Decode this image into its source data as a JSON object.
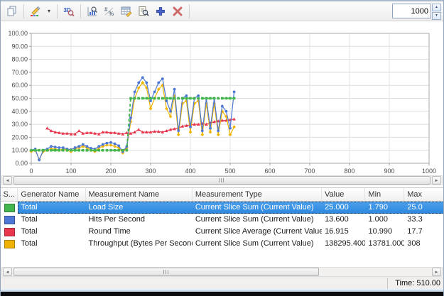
{
  "toolbar": {
    "icons": [
      {
        "name": "copy"
      },
      {
        "name": "edit-chart"
      },
      {
        "name": "zoom-3d"
      },
      {
        "name": "chart-zoom"
      },
      {
        "name": "number-format"
      },
      {
        "name": "edit-table"
      },
      {
        "name": "preview"
      },
      {
        "name": "add"
      },
      {
        "name": "delete"
      }
    ],
    "spinner_value": "1000"
  },
  "chart_data": {
    "type": "line",
    "title": "",
    "xlabel": "",
    "ylabel": "",
    "xlim": [
      0,
      1000
    ],
    "ylim": [
      0,
      100
    ],
    "x_tick_step": 100,
    "y_tick_step": 10,
    "grid": true,
    "legend_position": "table-below",
    "x": [
      0,
      10,
      20,
      30,
      40,
      50,
      60,
      70,
      80,
      90,
      100,
      110,
      120,
      130,
      140,
      150,
      160,
      170,
      180,
      190,
      200,
      210,
      220,
      230,
      240,
      250,
      260,
      270,
      280,
      290,
      300,
      310,
      320,
      330,
      340,
      350,
      360,
      370,
      380,
      390,
      400,
      410,
      420,
      430,
      440,
      450,
      460,
      470,
      480,
      490,
      500,
      510
    ],
    "series": [
      {
        "name": "Load Size",
        "color": "#44b64e",
        "marker": "square",
        "dash": true,
        "values": [
          10,
          10,
          10,
          10,
          10,
          10,
          10,
          10,
          10,
          10,
          10,
          10,
          10,
          10,
          10,
          10,
          10,
          10,
          10,
          10,
          10,
          10,
          10,
          10,
          10,
          50,
          50,
          50,
          50,
          50,
          50,
          50,
          50,
          50,
          50,
          50,
          50,
          50,
          50,
          50,
          50,
          50,
          50,
          50,
          50,
          50,
          50,
          50,
          50,
          50,
          50,
          50
        ]
      },
      {
        "name": "Hits Per Second",
        "color": "#4c77d4",
        "marker": "circle",
        "dash": false,
        "values": [
          10,
          11,
          2.5,
          10,
          11,
          13,
          12.5,
          12,
          12,
          11,
          10.5,
          12,
          13,
          14.5,
          13,
          11.5,
          11,
          13,
          14.5,
          15.5,
          16,
          15,
          13.5,
          9,
          13,
          35,
          55,
          62,
          66,
          62,
          48,
          55,
          62,
          65,
          48,
          40,
          57,
          25,
          50,
          52,
          28,
          50,
          52,
          25,
          50,
          27,
          50,
          25,
          44,
          40,
          27,
          55
        ]
      },
      {
        "name": "Round Time",
        "color": "#e8364c",
        "marker": "triangle",
        "dash": false,
        "x": [
          40,
          50,
          60,
          70,
          80,
          90,
          100,
          110,
          120,
          130,
          140,
          150,
          160,
          170,
          180,
          190,
          200,
          210,
          220,
          230,
          240,
          250,
          260,
          270,
          280,
          290,
          300,
          310,
          320,
          330,
          340,
          350,
          360,
          370,
          380,
          390,
          400,
          410,
          420,
          430,
          440,
          450,
          460,
          470,
          480,
          490,
          500,
          510
        ],
        "values": [
          27,
          25,
          24,
          23.5,
          23,
          23,
          22.5,
          22.5,
          25,
          23,
          23.5,
          23.5,
          23,
          22.5,
          24,
          24,
          23.5,
          23.5,
          23,
          22.5,
          23.5,
          23,
          24,
          26,
          24,
          24,
          24,
          24.5,
          24.5,
          24,
          25,
          26,
          26.5,
          27,
          28.5,
          29,
          29.5,
          30,
          30,
          30.5,
          30,
          31,
          32,
          32.5,
          33,
          33,
          33.5,
          34
        ]
      },
      {
        "name": "Throughput (Bytes Per Second)",
        "color": "#f0b400",
        "marker": "diamond",
        "dash": false,
        "values": [
          9,
          10,
          3,
          9,
          10,
          11,
          11,
          10,
          11,
          10,
          9,
          11,
          12,
          13,
          12,
          10,
          9,
          12,
          13,
          14,
          14,
          13,
          12,
          8,
          12,
          32,
          50,
          58,
          62,
          58,
          42,
          50,
          57,
          60,
          42,
          36,
          52,
          22,
          46,
          48,
          24,
          46,
          48,
          22,
          46,
          24,
          46,
          22,
          40,
          36,
          22,
          28
        ]
      }
    ]
  },
  "table": {
    "columns": [
      "S...",
      "Generator Name",
      "Measurement Name",
      "Measurement Type",
      "Value",
      "Min",
      "Max"
    ],
    "rows": [
      {
        "color": "#44b64e",
        "generator": "Total",
        "name": "Load Size",
        "type": "Current Slice Sum (Current Value)",
        "value": "25.000",
        "min": "1.790",
        "max": "25.0",
        "selected": true
      },
      {
        "color": "#4c77d4",
        "generator": "Total",
        "name": "Hits Per Second",
        "type": "Current Slice Sum (Current Value)",
        "value": "13.600",
        "min": "1.000",
        "max": "33.3",
        "selected": false
      },
      {
        "color": "#e8364c",
        "generator": "Total",
        "name": "Round Time",
        "type": "Current Slice Average (Current Value)",
        "value": "16.915",
        "min": "10.990",
        "max": "17.7",
        "selected": false
      },
      {
        "color": "#f0b400",
        "generator": "Total",
        "name": "Throughput (Bytes Per Second)",
        "type": "Current Slice Sum (Current Value)",
        "value": "138295.400",
        "min": "13781.000",
        "max": "308",
        "selected": false
      }
    ]
  },
  "statusbar": {
    "time": "Time: 510.00"
  }
}
